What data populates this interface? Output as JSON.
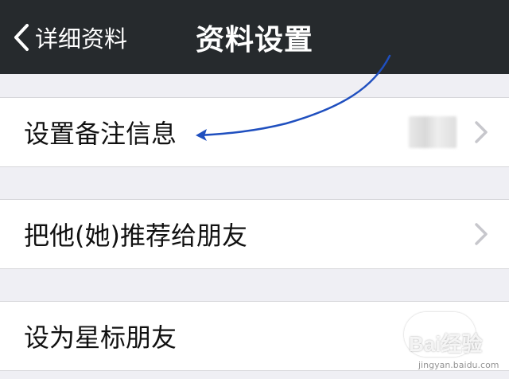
{
  "navbar": {
    "back_label": "详细资料",
    "title": "资料设置",
    "background": "#262a2d"
  },
  "rows": [
    {
      "label": "设置备注信息",
      "has_value": true,
      "value_blurred": true,
      "chevron": true
    },
    {
      "label": "把他(她)推荐给朋友",
      "has_value": false,
      "chevron": true
    },
    {
      "label": "设为星标朋友",
      "has_value": false,
      "chevron": false
    }
  ],
  "annotation": {
    "color": "#1f4fbf",
    "type": "arrow"
  },
  "watermark": {
    "brand": "Bai",
    "suffix": "经验",
    "sub": "jingyan.baidu.com"
  },
  "icons": {
    "back": "chevron-left-icon",
    "row": "chevron-right-icon"
  },
  "colors": {
    "page_bg": "#efeff4",
    "cell_bg": "#ffffff",
    "chevron": "#c7c7cc"
  }
}
